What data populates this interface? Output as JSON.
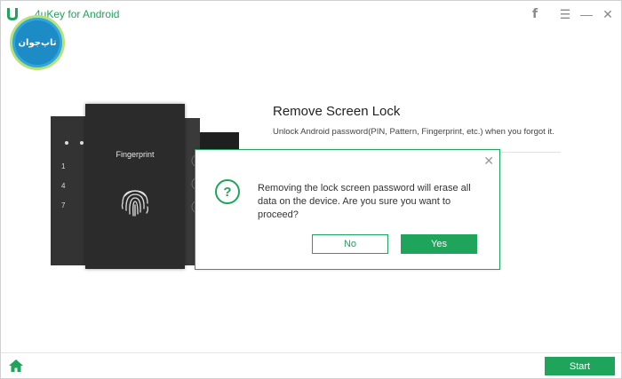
{
  "app": {
    "title": "4uKey for Android",
    "accent_color": "#1fa55b"
  },
  "titlebar": {
    "icons": [
      "facebook-icon",
      "menu-icon",
      "minimize-icon",
      "close-icon"
    ],
    "facebook_glyph": "f",
    "menu_glyph": "☰",
    "minimize_glyph": "—",
    "close_glyph": "✕"
  },
  "watermark": {
    "text": "تاپ‌جوان"
  },
  "illustration": {
    "fingerprint_label": "Fingerprint",
    "numbers": [
      "1",
      "4",
      "7"
    ]
  },
  "section": {
    "title": "Remove Screen Lock",
    "description": "Unlock Android password(PIN, Pattern, Fingerprint, etc.) when you forgot it."
  },
  "dialog": {
    "message": "Removing the lock screen password will erase all data on the device. Are you sure you want to proceed?",
    "icon_glyph": "?",
    "close_glyph": "✕",
    "no_label": "No",
    "yes_label": "Yes"
  },
  "footer": {
    "start_label": "Start"
  }
}
